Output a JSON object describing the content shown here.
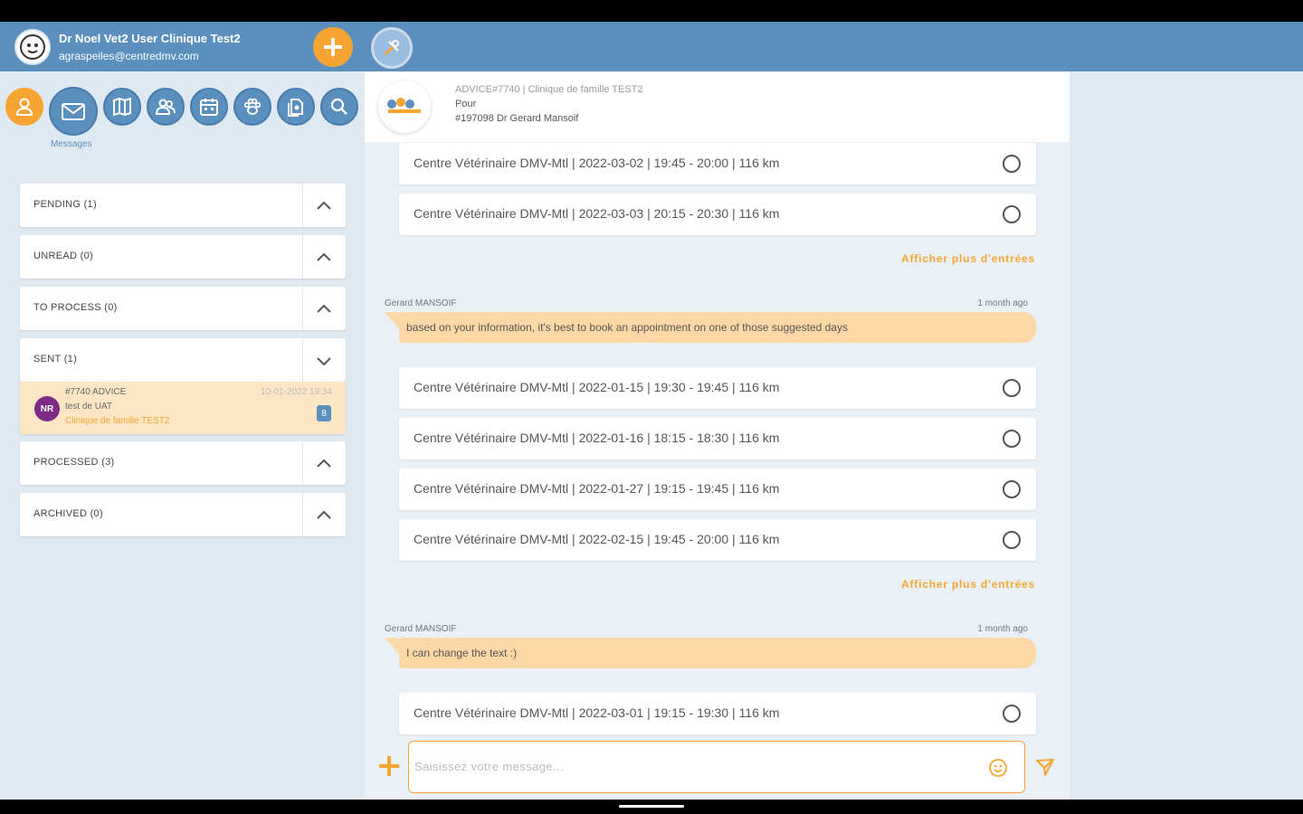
{
  "header": {
    "user_name": "Dr Noel Vet2 User Clinique Test2",
    "user_email": "agraspeiles@centredmv.com"
  },
  "nav": {
    "messages_label": "Messages"
  },
  "inbox": {
    "sections": [
      {
        "label": "PENDING (1)",
        "expanded": false
      },
      {
        "label": "UNREAD (0)",
        "expanded": false
      },
      {
        "label": "TO PROCESS (0)",
        "expanded": false
      },
      {
        "label": "SENT (1)",
        "expanded": true
      },
      {
        "label": "PROCESSED (3)",
        "expanded": false
      },
      {
        "label": "ARCHIVED (0)",
        "expanded": false
      }
    ],
    "sent_item": {
      "avatar_initials": "NR",
      "title": "#7740 ADVICE",
      "subtitle": "test de UAT",
      "clinic": "Clinique de famille TEST2",
      "date": "10-01-2022 19:34",
      "badge": "8"
    }
  },
  "chat": {
    "header_line1": "ADVICE#7740 | Clinique de famille TEST2",
    "header_line2": "Pour",
    "header_line3": "#197098 Dr Gerard Mansoif",
    "show_more": "Afficher plus d'entrées",
    "slots_group1": [
      "Centre Vétérinaire DMV-Mtl | 2022-03-02 | 19:45 - 20:00 | 116 km",
      "Centre Vétérinaire DMV-Mtl | 2022-03-03 | 20:15 - 20:30 | 116 km"
    ],
    "message1": {
      "sender": "Gerard MANSOIF",
      "time": "1 month ago",
      "text": "based on your information, it's best to book an appointment on one of those suggested days"
    },
    "slots_group2": [
      "Centre Vétérinaire DMV-Mtl | 2022-01-15 | 19:30 - 19:45 | 116 km",
      "Centre Vétérinaire DMV-Mtl | 2022-01-16 | 18:15 - 18:30 | 116 km",
      "Centre Vétérinaire DMV-Mtl | 2022-01-27 | 19:15 - 19:45 | 116 km",
      "Centre Vétérinaire DMV-Mtl | 2022-02-15 | 19:45 - 20:00 | 116 km"
    ],
    "message2": {
      "sender": "Gerard MANSOIF",
      "time": "1 month ago",
      "text": "I can change the text :)"
    },
    "slots_group3": [
      "Centre Vétérinaire DMV-Mtl | 2022-03-01 | 19:15 - 19:30 | 116 km"
    ],
    "composer_placeholder": "Saisissez votre message..."
  },
  "colors": {
    "primary": "#5b8fbe",
    "accent": "#f6a532",
    "bubble": "#fbd8a5",
    "sent_highlight": "#fce6c6"
  }
}
